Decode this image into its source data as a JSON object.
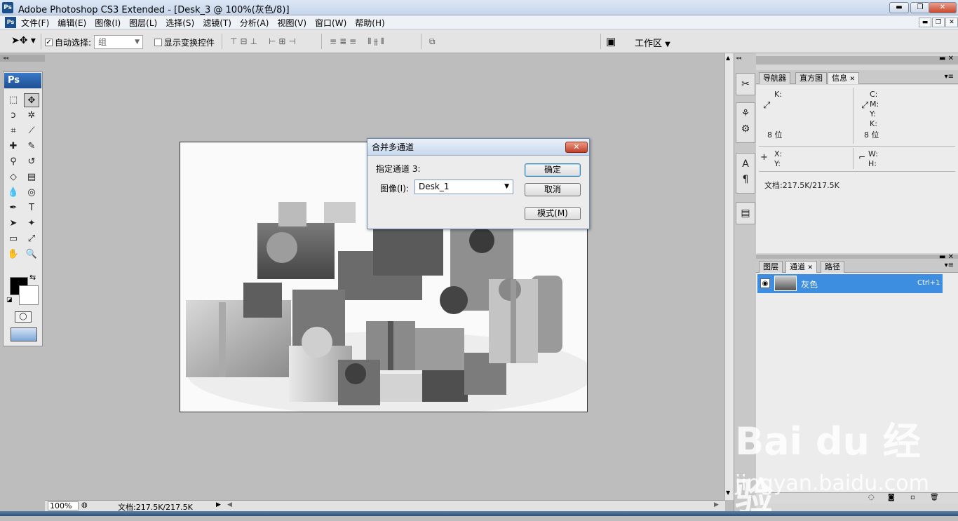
{
  "window": {
    "title": "Adobe Photoshop CS3 Extended - [Desk_3 @ 100%(灰色/8)]",
    "app_icon": "Ps",
    "buttons": {
      "minimize": "▬",
      "restore": "❐",
      "close": "✕"
    }
  },
  "menubar": {
    "items": [
      "文件(F)",
      "编辑(E)",
      "图像(I)",
      "图层(L)",
      "选择(S)",
      "滤镜(T)",
      "分析(A)",
      "视图(V)",
      "窗口(W)",
      "帮助(H)"
    ]
  },
  "options_bar": {
    "auto_select_label": "自动选择:",
    "auto_select_checked": true,
    "auto_select_value": "组",
    "show_transform_label": "显示变换控件",
    "show_transform_checked": false,
    "workspace_label": "工作区"
  },
  "toolbox": {
    "logo": "Ps",
    "tools": [
      {
        "name": "marquee-tool-icon",
        "glyph": "⬚"
      },
      {
        "name": "move-tool-icon",
        "glyph": "✥"
      },
      {
        "name": "lasso-tool-icon",
        "glyph": "ↄ"
      },
      {
        "name": "magic-wand-tool-icon",
        "glyph": "✲"
      },
      {
        "name": "crop-tool-icon",
        "glyph": "⌗"
      },
      {
        "name": "slice-tool-icon",
        "glyph": "⟋"
      },
      {
        "name": "healing-brush-tool-icon",
        "glyph": "✚"
      },
      {
        "name": "brush-tool-icon",
        "glyph": "✎"
      },
      {
        "name": "clone-stamp-tool-icon",
        "glyph": "⚲"
      },
      {
        "name": "history-brush-tool-icon",
        "glyph": "↺"
      },
      {
        "name": "eraser-tool-icon",
        "glyph": "◇"
      },
      {
        "name": "gradient-tool-icon",
        "glyph": "▤"
      },
      {
        "name": "blur-tool-icon",
        "glyph": "💧"
      },
      {
        "name": "dodge-tool-icon",
        "glyph": "◎"
      },
      {
        "name": "pen-tool-icon",
        "glyph": "✒"
      },
      {
        "name": "type-tool-icon",
        "glyph": "T"
      },
      {
        "name": "path-selection-tool-icon",
        "glyph": "➤"
      },
      {
        "name": "custom-shape-tool-icon",
        "glyph": "✦"
      },
      {
        "name": "notes-tool-icon",
        "glyph": "▭"
      },
      {
        "name": "eyedropper-tool-icon",
        "glyph": "⤢"
      },
      {
        "name": "hand-tool-icon",
        "glyph": "✋"
      },
      {
        "name": "zoom-tool-icon",
        "glyph": "🔍"
      }
    ]
  },
  "dialog": {
    "title": "合并多通道",
    "specify_channel_label": "指定通道 3:",
    "image_label": "图像(I):",
    "image_value": "Desk_1",
    "ok_label": "确定",
    "cancel_label": "取消",
    "mode_label": "模式(M)",
    "close_glyph": "✕"
  },
  "status_bar": {
    "zoom": "100%",
    "doc_info": "文档:217.5K/217.5K"
  },
  "info_panel": {
    "tabs": [
      "导航器",
      "直方图",
      "信息"
    ],
    "active_tab": "信息",
    "k_label": "K:",
    "bit_left": "8 位",
    "c_label": "C:",
    "m_label": "M:",
    "y_label": "Y:",
    "k2_label": "K:",
    "bit_right": "8 位",
    "x_label": "X:",
    "y2_label": "Y:",
    "w_label": "W:",
    "h_label": "H:",
    "doc_info": "文档:217.5K/217.5K"
  },
  "channels_panel": {
    "tabs": [
      "图层",
      "通道",
      "路径"
    ],
    "active_tab": "通道",
    "channel_name": "灰色",
    "channel_shortcut": "Ctrl+1"
  },
  "watermark": {
    "brand": "Bai du 经验",
    "url": "jingyan.baidu.com"
  }
}
